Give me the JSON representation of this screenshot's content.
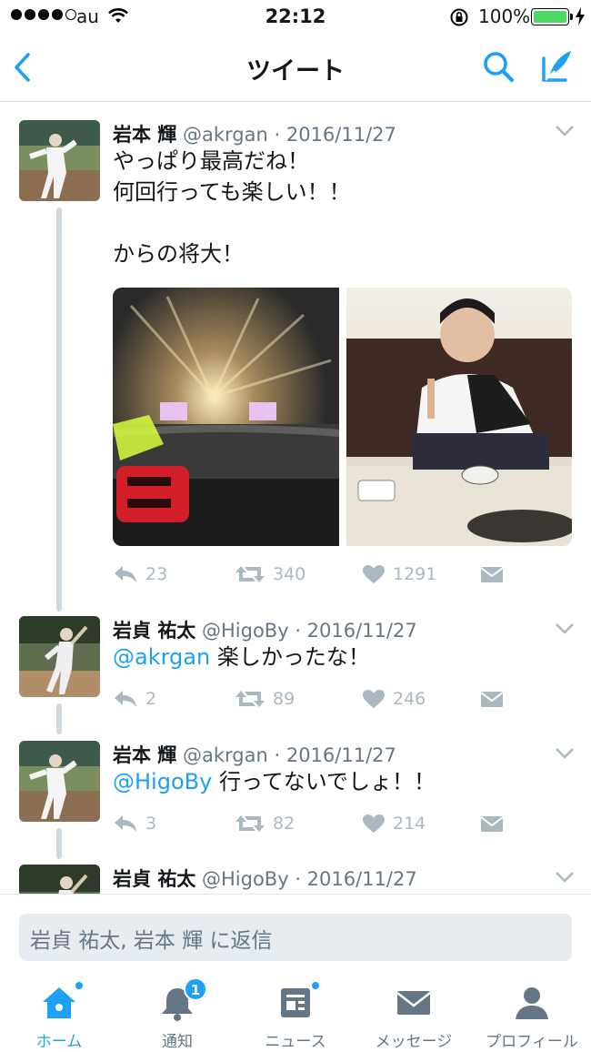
{
  "status_bar": {
    "carrier": "au",
    "time": "22:12",
    "battery": "100%"
  },
  "nav": {
    "title": "ツイート",
    "back_icon": "chevron-left-icon",
    "search_icon": "search-icon",
    "compose_icon": "compose-icon"
  },
  "tweets": [
    {
      "name": "岩本 輝",
      "handle": "@akrgan · 2016/11/27",
      "text": "やっぱり最高だね！\n何回行っても楽しい！！\n\nからの将大！",
      "replies": "23",
      "retweets": "340",
      "likes": "1291"
    },
    {
      "name": "岩貞 祐太",
      "handle": "@HigoBy · 2016/11/27",
      "mention": "@akrgan",
      "text": " 楽しかったな！",
      "replies": "2",
      "retweets": "89",
      "likes": "246"
    },
    {
      "name": "岩本 輝",
      "handle": "@akrgan · 2016/11/27",
      "mention": "@HigoBy",
      "text": " 行ってないでしょ！！",
      "replies": "3",
      "retweets": "82",
      "likes": "214"
    },
    {
      "name": "岩貞 祐太",
      "handle": "@HigoBy · 2016/11/27"
    }
  ],
  "reply_bar": {
    "placeholder": "岩貞 祐太, 岩本 輝 に返信"
  },
  "tabs": [
    {
      "label": "ホーム",
      "icon": "home-icon",
      "active": true
    },
    {
      "label": "通知",
      "icon": "bell-icon",
      "badge": "1"
    },
    {
      "label": "ニュース",
      "icon": "news-icon"
    },
    {
      "label": "メッセージ",
      "icon": "envelope-icon"
    },
    {
      "label": "プロフィール",
      "icon": "person-icon"
    }
  ],
  "colors": {
    "accent": "#1da1f2",
    "muted": "#657786",
    "action": "#aab8c2",
    "battery": "#4cd964"
  }
}
